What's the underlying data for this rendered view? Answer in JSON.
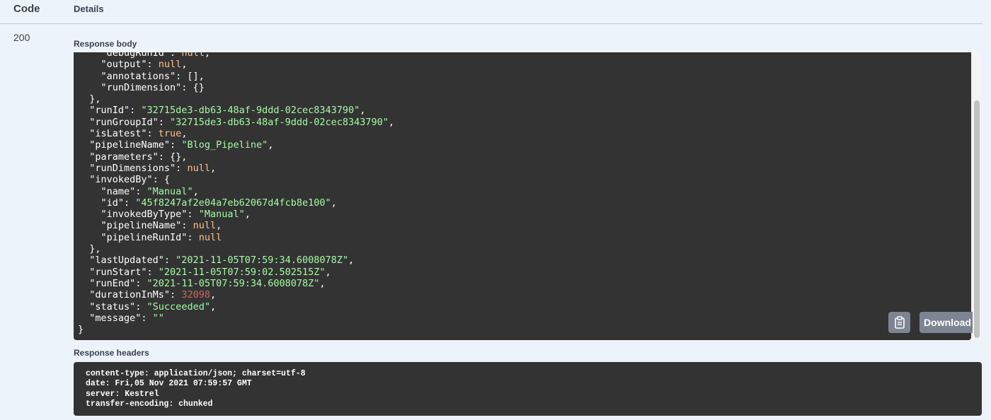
{
  "table_header": {
    "code": "Code",
    "details": "Details"
  },
  "response": {
    "status_code": "200",
    "body_label": "Response body",
    "body_lines": [
      [
        [
          "    \"debugRunId\": ",
          ""
        ],
        [
          "null",
          "n"
        ],
        [
          ",",
          ""
        ]
      ],
      [
        [
          "    \"output\": ",
          ""
        ],
        [
          "null",
          "n"
        ],
        [
          ",",
          ""
        ]
      ],
      [
        [
          "    \"annotations\": [],",
          ""
        ]
      ],
      [
        [
          "    \"runDimension\": {}",
          ""
        ]
      ],
      [
        [
          "  },",
          ""
        ]
      ],
      [
        [
          "  \"runId\": ",
          ""
        ],
        [
          "\"32715de3-db63-48af-9ddd-02cec8343790\"",
          "s"
        ],
        [
          ",",
          ""
        ]
      ],
      [
        [
          "  \"runGroupId\": ",
          ""
        ],
        [
          "\"32715de3-db63-48af-9ddd-02cec8343790\"",
          "s"
        ],
        [
          ",",
          ""
        ]
      ],
      [
        [
          "  \"isLatest\": ",
          ""
        ],
        [
          "true",
          "n"
        ],
        [
          ",",
          ""
        ]
      ],
      [
        [
          "  \"pipelineName\": ",
          ""
        ],
        [
          "\"Blog_Pipeline\"",
          "s"
        ],
        [
          ",",
          ""
        ]
      ],
      [
        [
          "  \"parameters\": {},",
          ""
        ]
      ],
      [
        [
          "  \"runDimensions\": ",
          ""
        ],
        [
          "null",
          "n"
        ],
        [
          ",",
          ""
        ]
      ],
      [
        [
          "  \"invokedBy\": {",
          ""
        ]
      ],
      [
        [
          "    \"name\": ",
          ""
        ],
        [
          "\"Manual\"",
          "s"
        ],
        [
          ",",
          ""
        ]
      ],
      [
        [
          "    \"id\": ",
          ""
        ],
        [
          "\"45f8247af2e04a7eb62067d4fcb8e100\"",
          "s"
        ],
        [
          ",",
          ""
        ]
      ],
      [
        [
          "    \"invokedByType\": ",
          ""
        ],
        [
          "\"Manual\"",
          "s"
        ],
        [
          ",",
          ""
        ]
      ],
      [
        [
          "    \"pipelineName\": ",
          ""
        ],
        [
          "null",
          "n"
        ],
        [
          ",",
          ""
        ]
      ],
      [
        [
          "    \"pipelineRunId\": ",
          ""
        ],
        [
          "null",
          "n"
        ]
      ],
      [
        [
          "  },",
          ""
        ]
      ],
      [
        [
          "  \"lastUpdated\": ",
          ""
        ],
        [
          "\"2021-11-05T07:59:34.6008078Z\"",
          "s"
        ],
        [
          ",",
          ""
        ]
      ],
      [
        [
          "  \"runStart\": ",
          ""
        ],
        [
          "\"2021-11-05T07:59:02.502515Z\"",
          "s"
        ],
        [
          ",",
          ""
        ]
      ],
      [
        [
          "  \"runEnd\": ",
          ""
        ],
        [
          "\"2021-11-05T07:59:34.6008078Z\"",
          "s"
        ],
        [
          ",",
          ""
        ]
      ],
      [
        [
          "  \"durationInMs\": ",
          ""
        ],
        [
          "32098",
          "num"
        ],
        [
          ",",
          ""
        ]
      ],
      [
        [
          "  \"status\": ",
          ""
        ],
        [
          "\"Succeeded\"",
          "s"
        ],
        [
          ",",
          ""
        ]
      ],
      [
        [
          "  \"message\": ",
          ""
        ],
        [
          "\"\"",
          "s"
        ]
      ],
      [
        [
          "}",
          ""
        ]
      ]
    ],
    "copy_icon": "clipboard-icon",
    "download_label": "Download",
    "headers_label": "Response headers",
    "header_lines": [
      "content-type: application/json; charset=utf-8",
      "date: Fri,05 Nov 2021 07:59:57 GMT",
      "server: Kestrel",
      "transfer-encoding: chunked"
    ]
  },
  "colors": {
    "page_bg": "#edf3fb",
    "code_bg": "#333333",
    "string": "#a2fca2",
    "keyword": "#fcc28c",
    "number": "#d36363",
    "button_bg": "#7d8492"
  }
}
